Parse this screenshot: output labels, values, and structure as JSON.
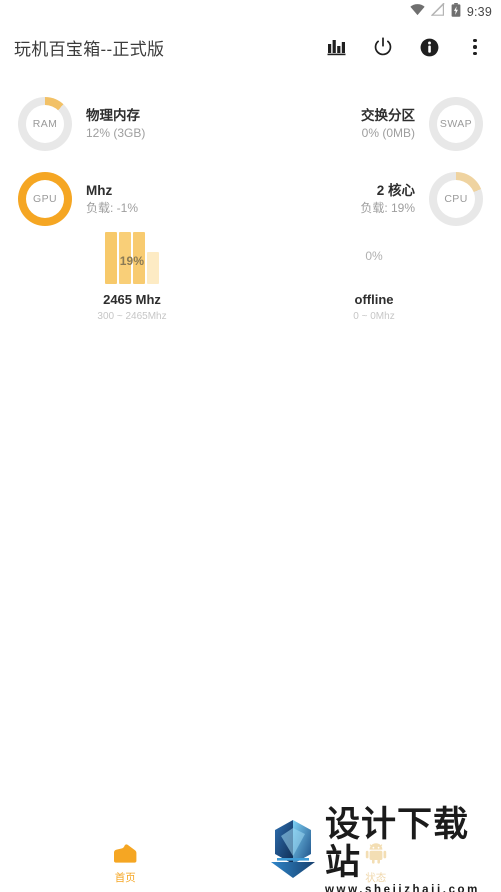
{
  "status_bar": {
    "time": "9:39",
    "icons": [
      "wifi-icon",
      "signal-off-icon",
      "battery-charging-icon"
    ]
  },
  "app_bar": {
    "title": "玩机百宝箱--正式版",
    "actions": [
      {
        "name": "bar-chart-icon",
        "label": "统计"
      },
      {
        "name": "power-icon",
        "label": "电源"
      },
      {
        "name": "info-icon",
        "label": "信息"
      },
      {
        "name": "overflow-menu-icon",
        "label": "更多"
      }
    ]
  },
  "stats": [
    {
      "id": "ram",
      "badge": "RAM",
      "title": "物理内存",
      "subtitle": "12% (3GB)",
      "percent": 12,
      "align": "left",
      "ring_color": "#F2C166",
      "track_color": "#E8E8E8"
    },
    {
      "id": "swap",
      "badge": "SWAP",
      "title": "交换分区",
      "subtitle": "0% (0MB)",
      "percent": 0,
      "align": "right",
      "ring_color": "#F2C166",
      "track_color": "#E8E8E8"
    },
    {
      "id": "gpu",
      "badge": "GPU",
      "title": "Mhz",
      "subtitle": "负载: -1%",
      "percent": 100,
      "align": "left",
      "ring_color": "#F5A623",
      "track_color": "#F5A623"
    },
    {
      "id": "cpu",
      "badge": "CPU",
      "title": "2 核心",
      "subtitle": "负载: 19%",
      "percent": 19,
      "align": "right",
      "ring_color": "#EFD3A0",
      "track_color": "#E8E8E8"
    }
  ],
  "chart_data": {
    "type": "bar",
    "title": "",
    "cores": [
      {
        "name": "core-0",
        "percent_label": "19%",
        "frequency": "2465 Mhz",
        "range": "300 ~ 2465Mhz",
        "online": true,
        "bars": [
          {
            "height_pct": 100,
            "color": "#F7C96A"
          },
          {
            "height_pct": 100,
            "color": "#F9CF78"
          },
          {
            "height_pct": 100,
            "color": "#F8CB70"
          },
          {
            "height_pct": 62,
            "color": "#FDEBC4"
          }
        ]
      },
      {
        "name": "core-1",
        "percent_label": "0%",
        "frequency": "offline",
        "range": "0 ~ 0Mhz",
        "online": false,
        "bars": []
      }
    ]
  },
  "bottom_nav": {
    "tabs": [
      {
        "id": "home",
        "label": "首页",
        "icon": "home-icon",
        "active": true
      },
      {
        "id": "status",
        "label": "状态",
        "icon": "android-robot-icon",
        "active": false
      }
    ]
  },
  "watermark": {
    "icon": "download-arrow-logo",
    "brand": "设计下载站",
    "url": "www.shejizhaji.com"
  },
  "theme": {
    "accent": "#F5A623",
    "accent_light": "#F7C96A",
    "text_primary": "#2e2e2e",
    "text_secondary": "#9e9e9e"
  }
}
